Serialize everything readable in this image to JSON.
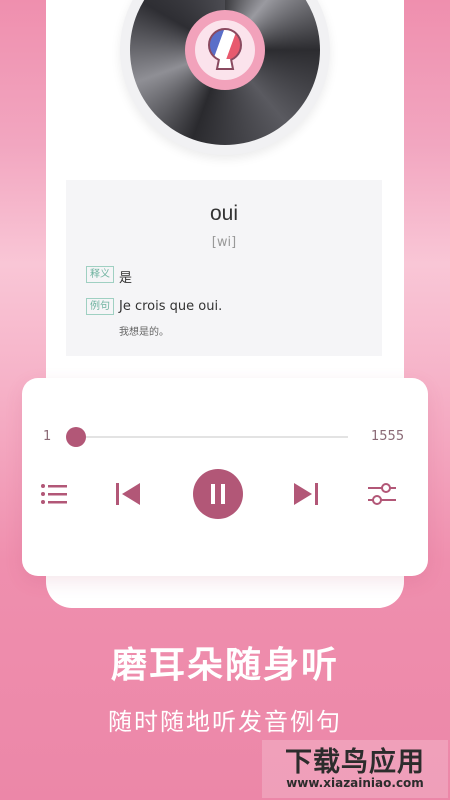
{
  "word_card": {
    "word": "oui",
    "phonetic": "[wi]",
    "meaning_tag": "释义",
    "meaning": "是",
    "example_tag": "例句",
    "example": "Je crois que oui.",
    "example_translation": "我想是的。"
  },
  "player": {
    "current": "1",
    "total": "1555",
    "progress_fraction": 0.0,
    "state": "playing"
  },
  "promo": {
    "headline": "磨耳朵随身听",
    "subline": "随时随地听发音例句"
  },
  "watermark": {
    "title": "下载鸟应用",
    "url": "www.xiazainiao.com"
  },
  "colors": {
    "accent": "#b25777",
    "background": "#ef8fae",
    "tag_border": "#9fd0c2"
  },
  "icons": [
    "flag-icon",
    "playlist-icon",
    "previous-icon",
    "pause-icon",
    "next-icon",
    "settings-sliders-icon"
  ]
}
